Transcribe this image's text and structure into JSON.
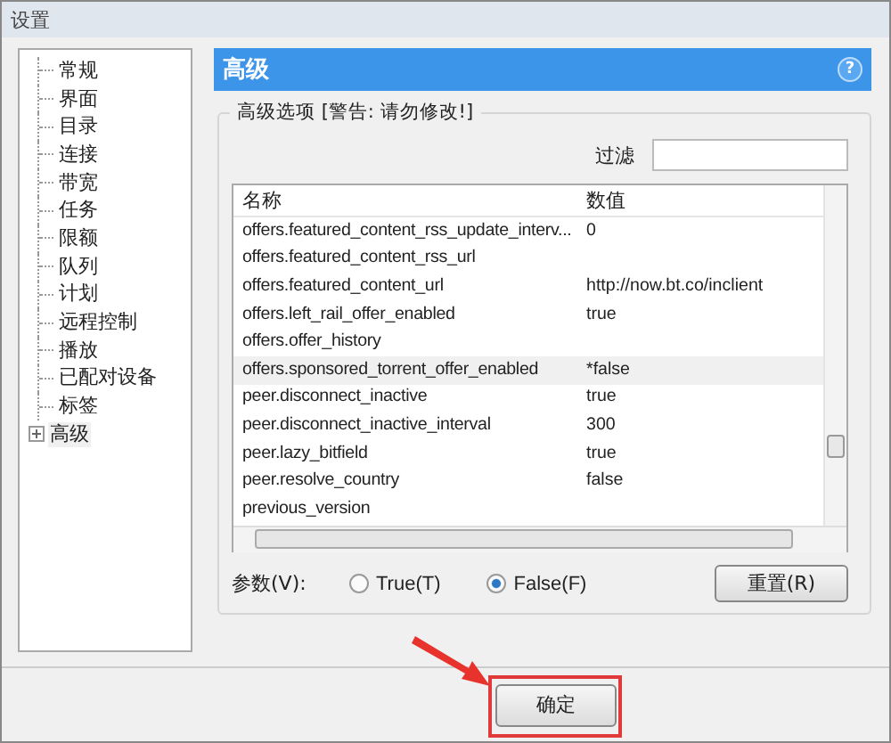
{
  "window": {
    "title": "设置"
  },
  "sidebar": {
    "items": [
      {
        "label": "常规",
        "selected": false,
        "expandable": false
      },
      {
        "label": "界面",
        "selected": false,
        "expandable": false
      },
      {
        "label": "目录",
        "selected": false,
        "expandable": false
      },
      {
        "label": "连接",
        "selected": false,
        "expandable": false
      },
      {
        "label": "带宽",
        "selected": false,
        "expandable": false
      },
      {
        "label": "任务",
        "selected": false,
        "expandable": false
      },
      {
        "label": "限额",
        "selected": false,
        "expandable": false
      },
      {
        "label": "队列",
        "selected": false,
        "expandable": false
      },
      {
        "label": "计划",
        "selected": false,
        "expandable": false
      },
      {
        "label": "远程控制",
        "selected": false,
        "expandable": false
      },
      {
        "label": "播放",
        "selected": false,
        "expandable": false
      },
      {
        "label": "已配对设备",
        "selected": false,
        "expandable": false
      },
      {
        "label": "标签",
        "selected": false,
        "expandable": false
      },
      {
        "label": "高级",
        "selected": true,
        "expandable": true
      }
    ]
  },
  "panel": {
    "title": "高级",
    "group_title": "高级选项 [警告: 请勿修改!]",
    "help": "?",
    "filter": {
      "label": "过滤"
    },
    "table": {
      "columns": [
        "名称",
        "数值"
      ],
      "rows": [
        {
          "name": "offers.featured_content_rss_update_interv...",
          "value": "0",
          "selected": false
        },
        {
          "name": "offers.featured_content_rss_url",
          "value": "",
          "selected": false
        },
        {
          "name": "offers.featured_content_url",
          "value": "http://now.bt.co/inclient",
          "selected": false
        },
        {
          "name": "offers.left_rail_offer_enabled",
          "value": "true",
          "selected": false
        },
        {
          "name": "offers.offer_history",
          "value": "",
          "selected": false
        },
        {
          "name": "offers.sponsored_torrent_offer_enabled",
          "value": "*false",
          "selected": true
        },
        {
          "name": "peer.disconnect_inactive",
          "value": "true",
          "selected": false
        },
        {
          "name": "peer.disconnect_inactive_interval",
          "value": "300",
          "selected": false
        },
        {
          "name": "peer.lazy_bitfield",
          "value": "true",
          "selected": false
        },
        {
          "name": "peer.resolve_country",
          "value": "false",
          "selected": false
        },
        {
          "name": "previous_version",
          "value": "",
          "selected": false
        }
      ]
    },
    "param_label": "参数(V):",
    "options": [
      {
        "label": "True(T)",
        "selected": false
      },
      {
        "label": "False(F)",
        "selected": true
      }
    ],
    "reset_button": "重置(R)"
  },
  "buttons": [
    "确定"
  ]
}
